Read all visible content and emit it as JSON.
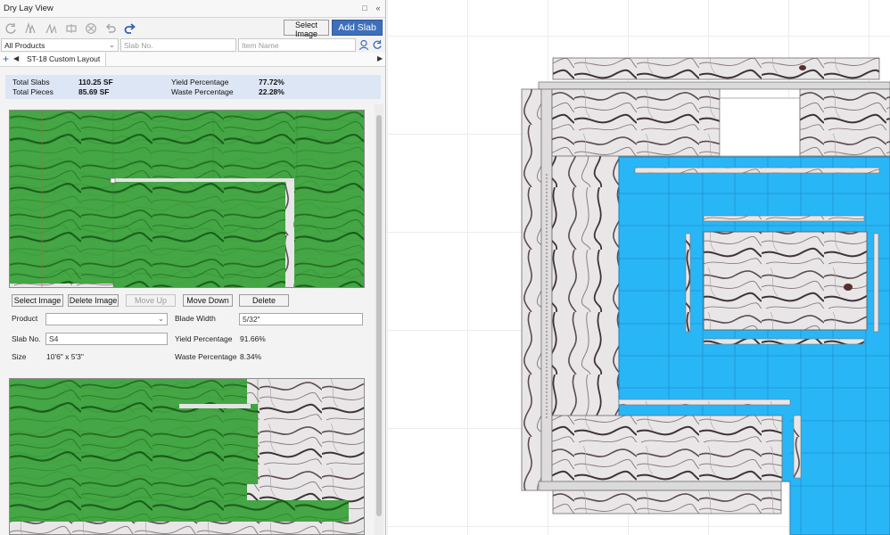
{
  "window": {
    "title": "Dry Lay View",
    "pin_icon": "pin-icon",
    "collapse_icon": "double-chevron-left-icon"
  },
  "toolbar": {
    "icons": [
      "refresh-icon",
      "layout-icon",
      "layout-alt-icon",
      "flip-icon",
      "cancel-icon",
      "undo-icon",
      "redo-icon"
    ],
    "select_image_label": "Select Image",
    "add_slab_label": "Add Slab"
  },
  "filters": {
    "product_value": "All Products",
    "slab_placeholder": "Slab No.",
    "item_placeholder": "Item Name",
    "search_icon": "user-search-icon",
    "reload_icon": "reload-icon"
  },
  "tabs": {
    "active": "ST-18 Custom Layout",
    "add_icon": "plus-icon"
  },
  "summary": {
    "total_slabs_label": "Total Slabs",
    "total_slabs_value": "110.25 SF",
    "total_pieces_label": "Total Pieces",
    "total_pieces_value": "85.69 SF",
    "yield_label": "Yield Percentage",
    "yield_value": "77.72%",
    "waste_label": "Waste Percentage",
    "waste_value": "22.28%"
  },
  "slab_actions": {
    "select_image": "Select Image",
    "delete_image": "Delete Image",
    "move_up": "Move Up",
    "move_down": "Move Down",
    "delete": "Delete"
  },
  "slab_details": {
    "product_label": "Product",
    "product_value": "",
    "blade_width_label": "Blade Width",
    "blade_width_value": "5/32\"",
    "slab_no_label": "Slab No.",
    "slab_no_value": "S4",
    "yield_label": "Yield Percentage",
    "yield_value": "91.66%",
    "size_label": "Size",
    "size_value": "10'6\" x 5'3\"",
    "waste_label": "Waste Percentage",
    "waste_value": "8.34%"
  },
  "colors": {
    "accent": "#3d6fba",
    "piece_overlay": "#2e9e2e",
    "layout_blue": "#29b6f6",
    "summary_bg": "#dde6f5"
  }
}
